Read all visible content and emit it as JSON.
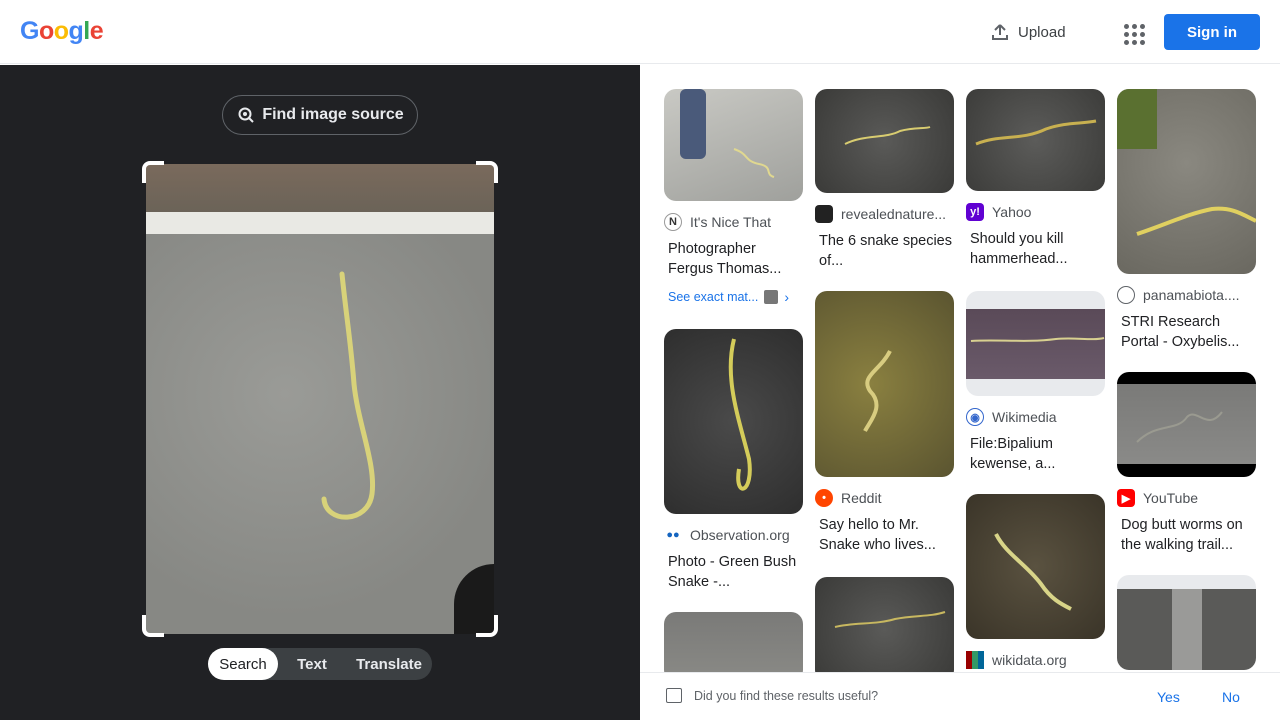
{
  "header": {
    "logo": "Google",
    "upload_label": "Upload",
    "apps_icon": "apps-grid-icon",
    "signin_label": "Sign in",
    "accent": "#1a73e8"
  },
  "left": {
    "find_source_label": "Find image source",
    "tabs": [
      {
        "label": "Search",
        "active": true
      },
      {
        "label": "Text",
        "active": false
      },
      {
        "label": "Translate",
        "active": false
      }
    ]
  },
  "results": [
    {
      "source": "It's Nice That",
      "title": "Photographer Fergus Thomas...",
      "exact": "See exact mat..."
    },
    {
      "source": "Observation.org",
      "title": "Photo - Green Bush Snake -..."
    },
    {
      "source": "revealednature...",
      "title": "The 6 snake species of..."
    },
    {
      "source": "Reddit",
      "title": "Say hello to Mr. Snake who lives..."
    },
    {
      "source": "Yahoo",
      "title": "Should you kill hammerhead..."
    },
    {
      "source": "Wikimedia",
      "title": "File:Bipalium kewense, a..."
    },
    {
      "source": "wikidata.org",
      "title": ""
    },
    {
      "source": "panamabiota....",
      "title": "STRI Research Portal - Oxybelis..."
    },
    {
      "source": "YouTube",
      "title": "Dog butt worms on the walking trail..."
    }
  ],
  "feedback": {
    "question": "Did you find these results useful?",
    "yes": "Yes",
    "no": "No"
  }
}
